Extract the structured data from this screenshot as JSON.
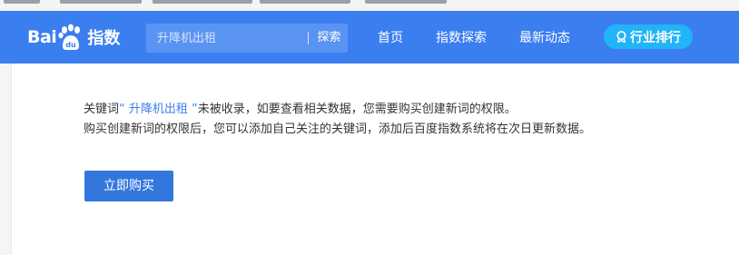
{
  "header": {
    "logo": {
      "text_bai": "Bai",
      "text_du": "du",
      "text_index": "指数"
    },
    "search": {
      "placeholder": "升降机出租",
      "button_label": "探索"
    },
    "nav": [
      {
        "label": "首页"
      },
      {
        "label": "指数探索"
      },
      {
        "label": "最新动态"
      }
    ],
    "rank_button": {
      "label": "行业排行"
    },
    "colors": {
      "bar": "#3b7ef0",
      "rank_button": "#21b4f9"
    }
  },
  "main": {
    "line1_prefix": "关键词",
    "keyword_quote": "“ 升降机出租 ”",
    "line1_suffix": "未被收录，如要查看相关数据，您需要购买创建新词的权限。",
    "line2": "购买创建新词的权限后，您可以添加自己关注的关键词，添加后百度指数系统将在次日更新数据。",
    "buy_button": "立即购买",
    "colors": {
      "buy_button": "#3377dd",
      "keyword": "#3b7ef0"
    }
  }
}
